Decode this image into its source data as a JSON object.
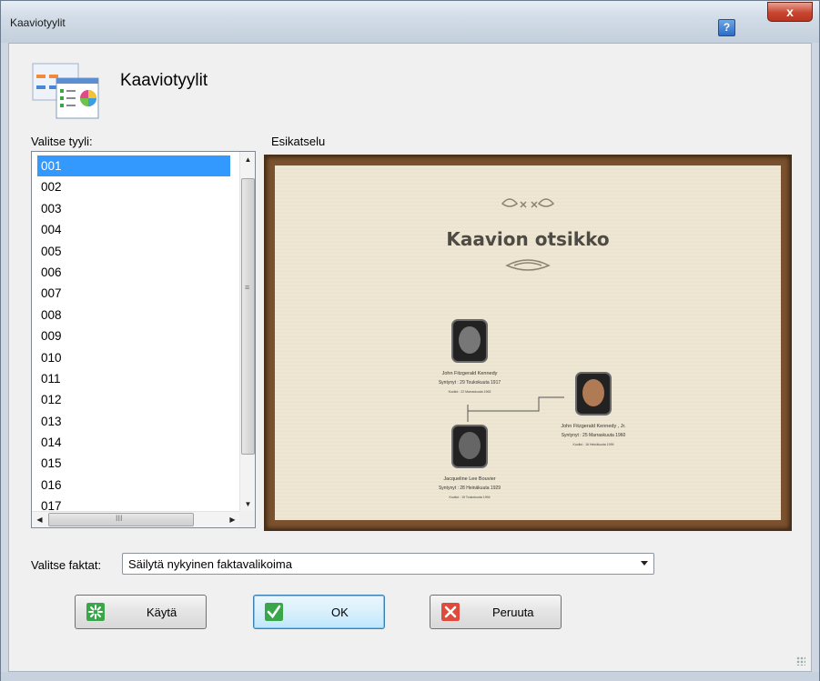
{
  "window": {
    "title": "Kaaviotyylit",
    "help_label": "?",
    "close_label": "x"
  },
  "header": {
    "title": "Kaaviotyylit",
    "icon": "chart-styles-icon"
  },
  "style_list": {
    "label": "Valitse tyyli:",
    "items": [
      "001",
      "002",
      "003",
      "004",
      "005",
      "006",
      "007",
      "008",
      "009",
      "010",
      "011",
      "012",
      "013",
      "014",
      "015",
      "016",
      "017"
    ],
    "selected": "001"
  },
  "preview": {
    "label": "Esikatselu",
    "chart_title": "Kaavion otsikko",
    "people": [
      {
        "name": "John  Fitzgerald  Kennedy",
        "born": "Syntynyt  :  29 Toukokuuta 1917",
        "died": "Kuollut  :  22 Marraskuuta  1963"
      },
      {
        "name": "John  Fitzgerald  Kennedy , Jr.",
        "born": "Syntynyt  :  25 Marraskuuta  1960",
        "died": "Kuollut  :  16 Heinäkuuta  1999"
      },
      {
        "name": "Jacqueline Lee  Bouvier",
        "born": "Syntynyt  :  28 Heinäkuuta  1929",
        "died": "Kuollut  :  19 Toukokuuta  1994"
      }
    ]
  },
  "facts": {
    "label": "Valitse faktat:",
    "value": "Säilytä nykyinen faktavalikoima"
  },
  "buttons": {
    "apply": "Käytä",
    "ok": "OK",
    "cancel": "Peruuta"
  },
  "colors": {
    "selection": "#3399ff",
    "frame": "#7a5230",
    "parchment": "#efe8d6"
  }
}
